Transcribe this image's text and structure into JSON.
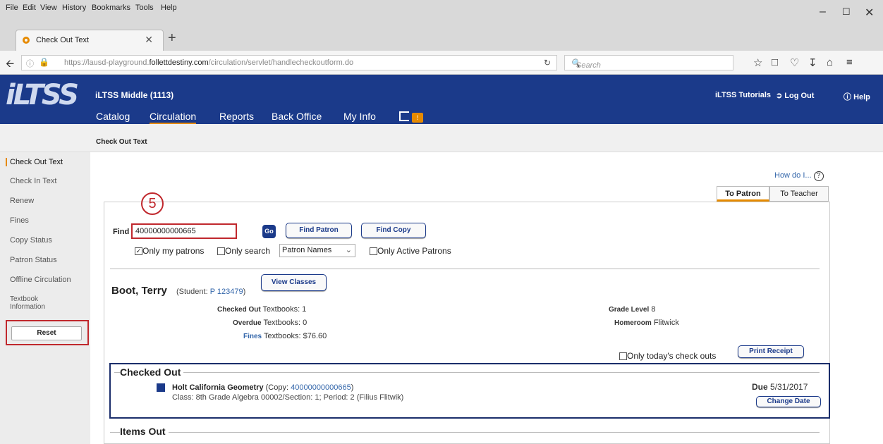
{
  "browser": {
    "menus": [
      "File",
      "Edit",
      "View",
      "History",
      "Bookmarks",
      "Tools",
      "Help"
    ],
    "tab_title": "Check Out Text",
    "url_prefix": "https://lausd-playground.",
    "url_domain": "follettdestiny.com",
    "url_path": "/circulation/servlet/handlecheckoutform.do",
    "search_placeholder": "Search"
  },
  "header": {
    "logo": "iLTSS",
    "school": "iLTSS Middle (1113)",
    "nav": [
      "Catalog",
      "Circulation",
      "Reports",
      "Back Office",
      "My Info"
    ],
    "active_nav": "Circulation",
    "flag_count": "!",
    "tutorials": "iLTSS Tutorials",
    "logout": "Log Out",
    "help": "Help"
  },
  "breadcrumb": "Check Out Text",
  "sidebar": {
    "items": [
      "Check Out Text",
      "Check In Text",
      "Renew",
      "Fines",
      "Copy Status",
      "Patron Status",
      "Offline Circulation",
      "Textbook Information"
    ],
    "reset": "Reset"
  },
  "main": {
    "howdo": "How do I...",
    "tabs": [
      "To Patron",
      "To Teacher"
    ],
    "step": "5",
    "find_label": "Find",
    "find_value": "40000000000665",
    "go": "Go",
    "find_patron": "Find Patron",
    "find_copy": "Find Copy",
    "only_my_patrons": "Only my patrons",
    "only_search": "Only search",
    "search_scope": "Patron Names",
    "only_active": "Only Active Patrons",
    "patron": {
      "name": "Boot, Terry",
      "sub_prefix": "(Student:",
      "id": "P 123479",
      "sub_suffix": ")",
      "view_classes": "View Classes",
      "checked_out_label": "Checked Out",
      "checked_out_value": "Textbooks: 1",
      "overdue_label": "Overdue",
      "overdue_value": "Textbooks: 0",
      "fines_label": "Fines",
      "fines_value": "Textbooks: $76.60",
      "grade_label": "Grade Level",
      "grade_value": "8",
      "homeroom_label": "Homeroom",
      "homeroom_value": "Flitwick"
    },
    "only_today": "Only today's check outs",
    "print_receipt": "Print Receipt",
    "checked_out_section": "Checked Out",
    "item": {
      "title": "Holt California Geometry",
      "copy_prefix": "(Copy:",
      "copy": "40000000000665",
      "copy_suffix": ")",
      "class_line": "Class: 8th Grade Algebra 00002/Section: 1; Period: 2",
      "teacher": "(Filius Flitwik)",
      "due_label": "Due",
      "due_date": "5/31/2017",
      "change_date": "Change Date"
    },
    "items_out_section": "Items Out"
  }
}
